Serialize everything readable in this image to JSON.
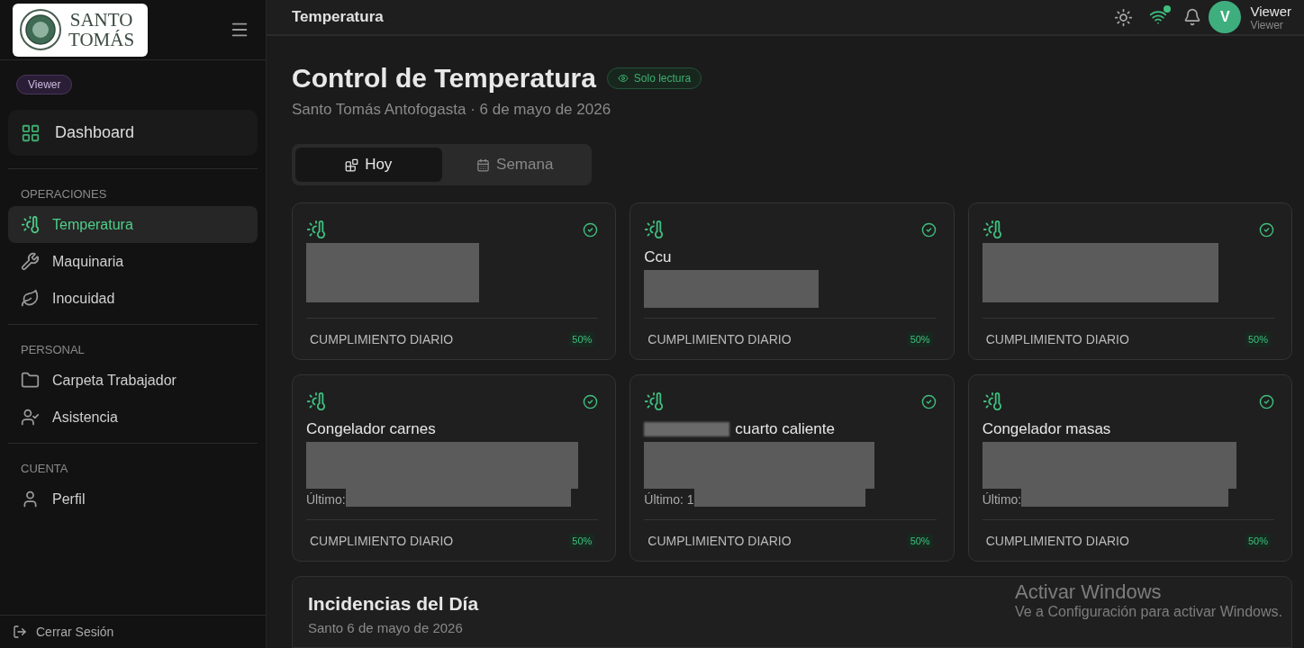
{
  "logo": {
    "lines": [
      "SANTO",
      "TOMÁS"
    ]
  },
  "sidebar": {
    "role_badge": "Viewer",
    "home": {
      "label": "Dashboard"
    },
    "sections": [
      {
        "heading": "OPERACIONES",
        "items": [
          {
            "label": "Temperatura",
            "selected": true
          },
          {
            "label": "Maquinaria",
            "selected": false
          },
          {
            "label": "Inocuidad",
            "selected": false
          }
        ]
      },
      {
        "heading": "PERSONAL",
        "items": [
          {
            "label": "Carpeta Trabajador",
            "selected": false
          },
          {
            "label": "Asistencia",
            "selected": false
          }
        ]
      },
      {
        "heading": "CUENTA",
        "items": [
          {
            "label": "Perfil",
            "selected": false
          }
        ]
      }
    ],
    "logout": "Cerrar Sesión"
  },
  "header": {
    "title": "Temperatura",
    "connected": true,
    "user": {
      "initial": "V",
      "name": "Viewer",
      "role": "Viewer"
    }
  },
  "page": {
    "title": "Control de Temperatura",
    "badge": "Solo lectura",
    "subtitle": "Santo Tomás Antofogasta · 6 de mayo de 2026"
  },
  "tabs": [
    {
      "label": "Hoy",
      "selected": true
    },
    {
      "label": "Semana",
      "selected": false
    }
  ],
  "cards": [
    {
      "ok": true,
      "compliance_label": "CUMPLIMIENTO DIARIO",
      "compliance": "50%"
    },
    {
      "title": "Ccu",
      "ok": true,
      "compliance_label": "CUMPLIMIENTO DIARIO",
      "compliance": "50%"
    },
    {
      "ok": true,
      "compliance_label": "CUMPLIMIENTO DIARIO",
      "compliance": "50%"
    },
    {
      "title": "Congelador carnes",
      "last": "Último:",
      "ok": true,
      "compliance_label": "CUMPLIMIENTO DIARIO",
      "compliance": "50%"
    },
    {
      "title": "cuarto caliente",
      "title_redacted": true,
      "last": "Último: 1",
      "ok": true,
      "compliance_label": "CUMPLIMIENTO DIARIO",
      "compliance": "50%"
    },
    {
      "title": "Congelador masas",
      "last": "Último:",
      "ok": true,
      "compliance_label": "CUMPLIMIENTO DIARIO",
      "compliance": "50%"
    }
  ],
  "incidents": {
    "title": "Incidencias del Día",
    "subtitle": "Santo 6 de mayo de 2026"
  },
  "os_notice": {
    "title": "Activar Windows",
    "text": "Ve a Configuración para activar Windows."
  }
}
